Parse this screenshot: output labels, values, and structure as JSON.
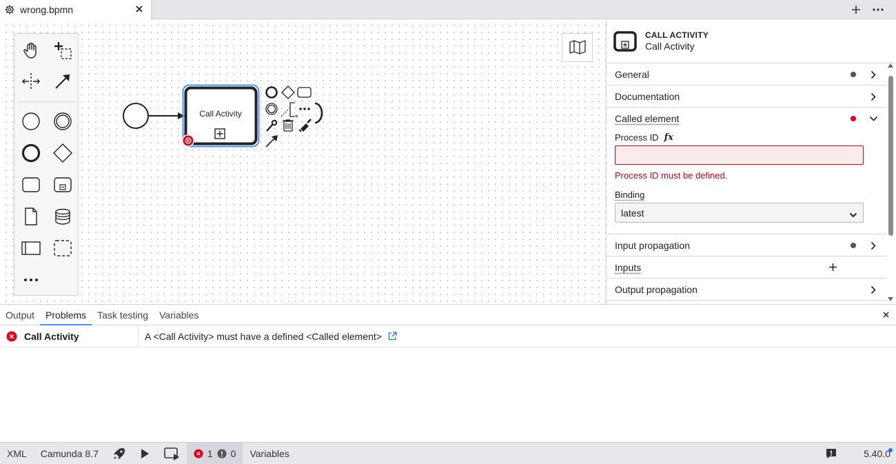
{
  "tab": {
    "title": "wrong.bpmn",
    "icon": "gear-icon"
  },
  "palette": {
    "tools": [
      "hand-tool-icon",
      "lasso-tool-icon",
      "space-tool-icon",
      "connect-tool-icon"
    ],
    "shapes": [
      "start-event-icon",
      "intermediate-event-icon",
      "end-event-icon",
      "gateway-icon",
      "task-icon",
      "subprocess-icon",
      "data-object-icon",
      "data-store-icon",
      "pool-icon",
      "group-icon",
      "more-icon"
    ]
  },
  "diagram": {
    "task_label": "Call Activity"
  },
  "properties": {
    "element_type": "CALL ACTIVITY",
    "element_name": "Call Activity",
    "groups": {
      "general": "General",
      "documentation": "Documentation",
      "called_element": "Called element",
      "input_propagation": "Input propagation",
      "inputs": "Inputs",
      "output_propagation": "Output propagation"
    },
    "process_id_label": "Process ID",
    "fx_label": "fx",
    "process_id_value": "",
    "process_id_error": "Process ID must be defined.",
    "binding_label": "Binding",
    "binding_value": "latest",
    "colors": {
      "error": "#e0001b",
      "selection": "#4d90ff"
    }
  },
  "bottom_panel": {
    "tabs": [
      "Output",
      "Problems",
      "Task testing",
      "Variables"
    ],
    "active_tab": "Problems",
    "problems": [
      {
        "severity": "error",
        "element": "Call Activity",
        "message": "A <Call Activity> must have a defined <Called element>"
      }
    ]
  },
  "status_bar": {
    "xml": "XML",
    "engine": "Camunda 8.7",
    "errors": "1",
    "warnings": "0",
    "variables": "Variables",
    "version": "5.40.0"
  }
}
